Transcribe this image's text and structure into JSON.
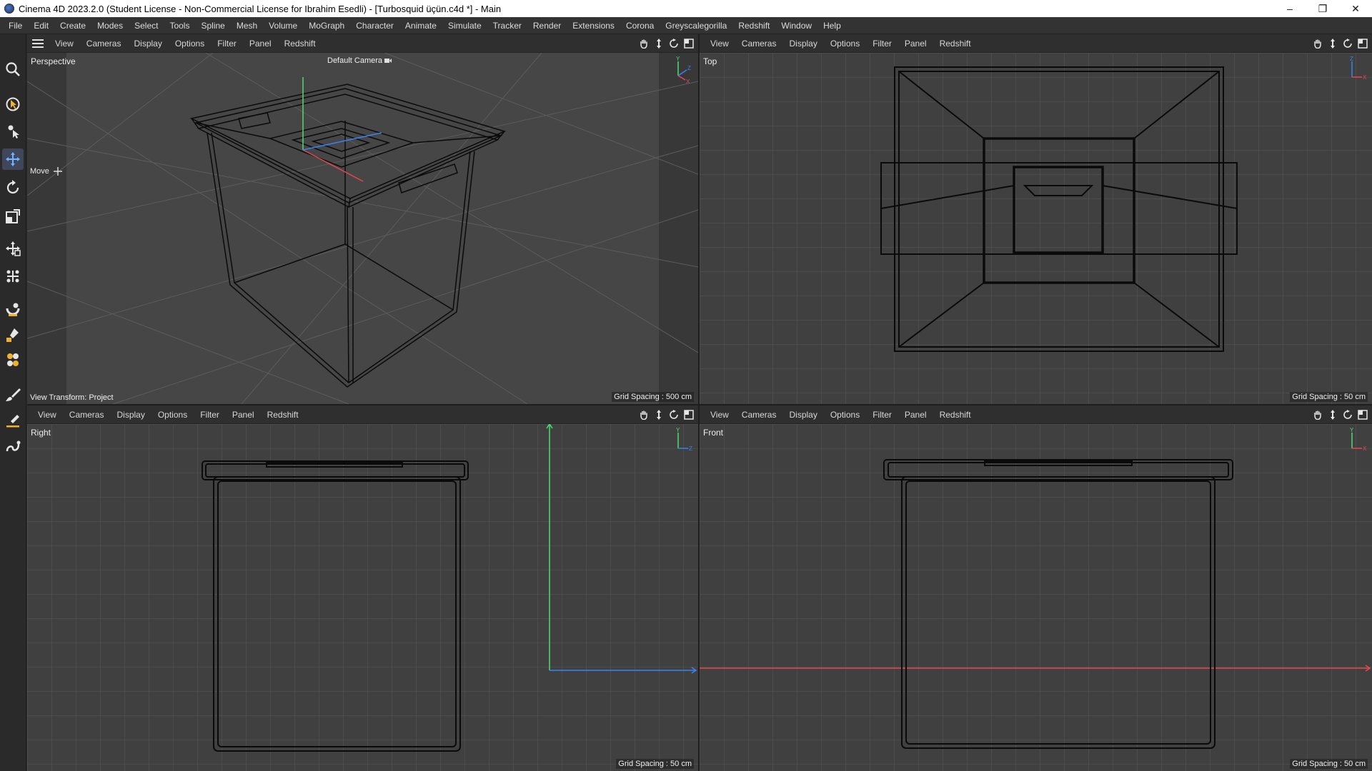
{
  "window": {
    "title": "Cinema 4D 2023.2.0 (Student License - Non-Commercial License for Ibrahim Esedli) - [Turbosquid üçün.c4d *] - Main",
    "minimize": "–",
    "maximize": "❐",
    "close": "✕"
  },
  "menubar": [
    "File",
    "Edit",
    "Create",
    "Modes",
    "Select",
    "Tools",
    "Spline",
    "Mesh",
    "Volume",
    "MoGraph",
    "Character",
    "Animate",
    "Simulate",
    "Tracker",
    "Render",
    "Extensions",
    "Corona",
    "Greyscalegorilla",
    "Redshift",
    "Window",
    "Help"
  ],
  "viewport_menu": [
    "View",
    "Cameras",
    "Display",
    "Options",
    "Filter",
    "Panel",
    "Redshift"
  ],
  "viewports": {
    "perspective": {
      "label": "Perspective",
      "camera": "Default Camera",
      "move_label": "Move",
      "view_transform": "View Transform: Project",
      "grid_spacing": "Grid Spacing : 500 cm"
    },
    "top": {
      "label": "Top",
      "grid_spacing": "Grid Spacing : 50 cm"
    },
    "right": {
      "label": "Right",
      "grid_spacing": "Grid Spacing : 50 cm"
    },
    "front": {
      "label": "Front",
      "grid_spacing": "Grid Spacing : 50 cm"
    }
  },
  "axis_labels": {
    "x": "X",
    "y": "Y",
    "z": "Z"
  },
  "tools": [
    "zoom-icon",
    "selection-icon",
    "live-select-icon",
    "move-icon",
    "rotate-icon",
    "scale-icon",
    "transform-icon",
    "scatter-icon",
    "magnet-icon",
    "paint-icon",
    "mesh-icon",
    "brush-icon",
    "knife-icon",
    "spline-pen-icon"
  ],
  "colors": {
    "background": "#404040",
    "grid": "#5a5a5a",
    "wire": "#0a0a0a",
    "axis_x": "#e8484f",
    "axis_y": "#4ddc6e",
    "axis_z": "#3a82f0"
  }
}
